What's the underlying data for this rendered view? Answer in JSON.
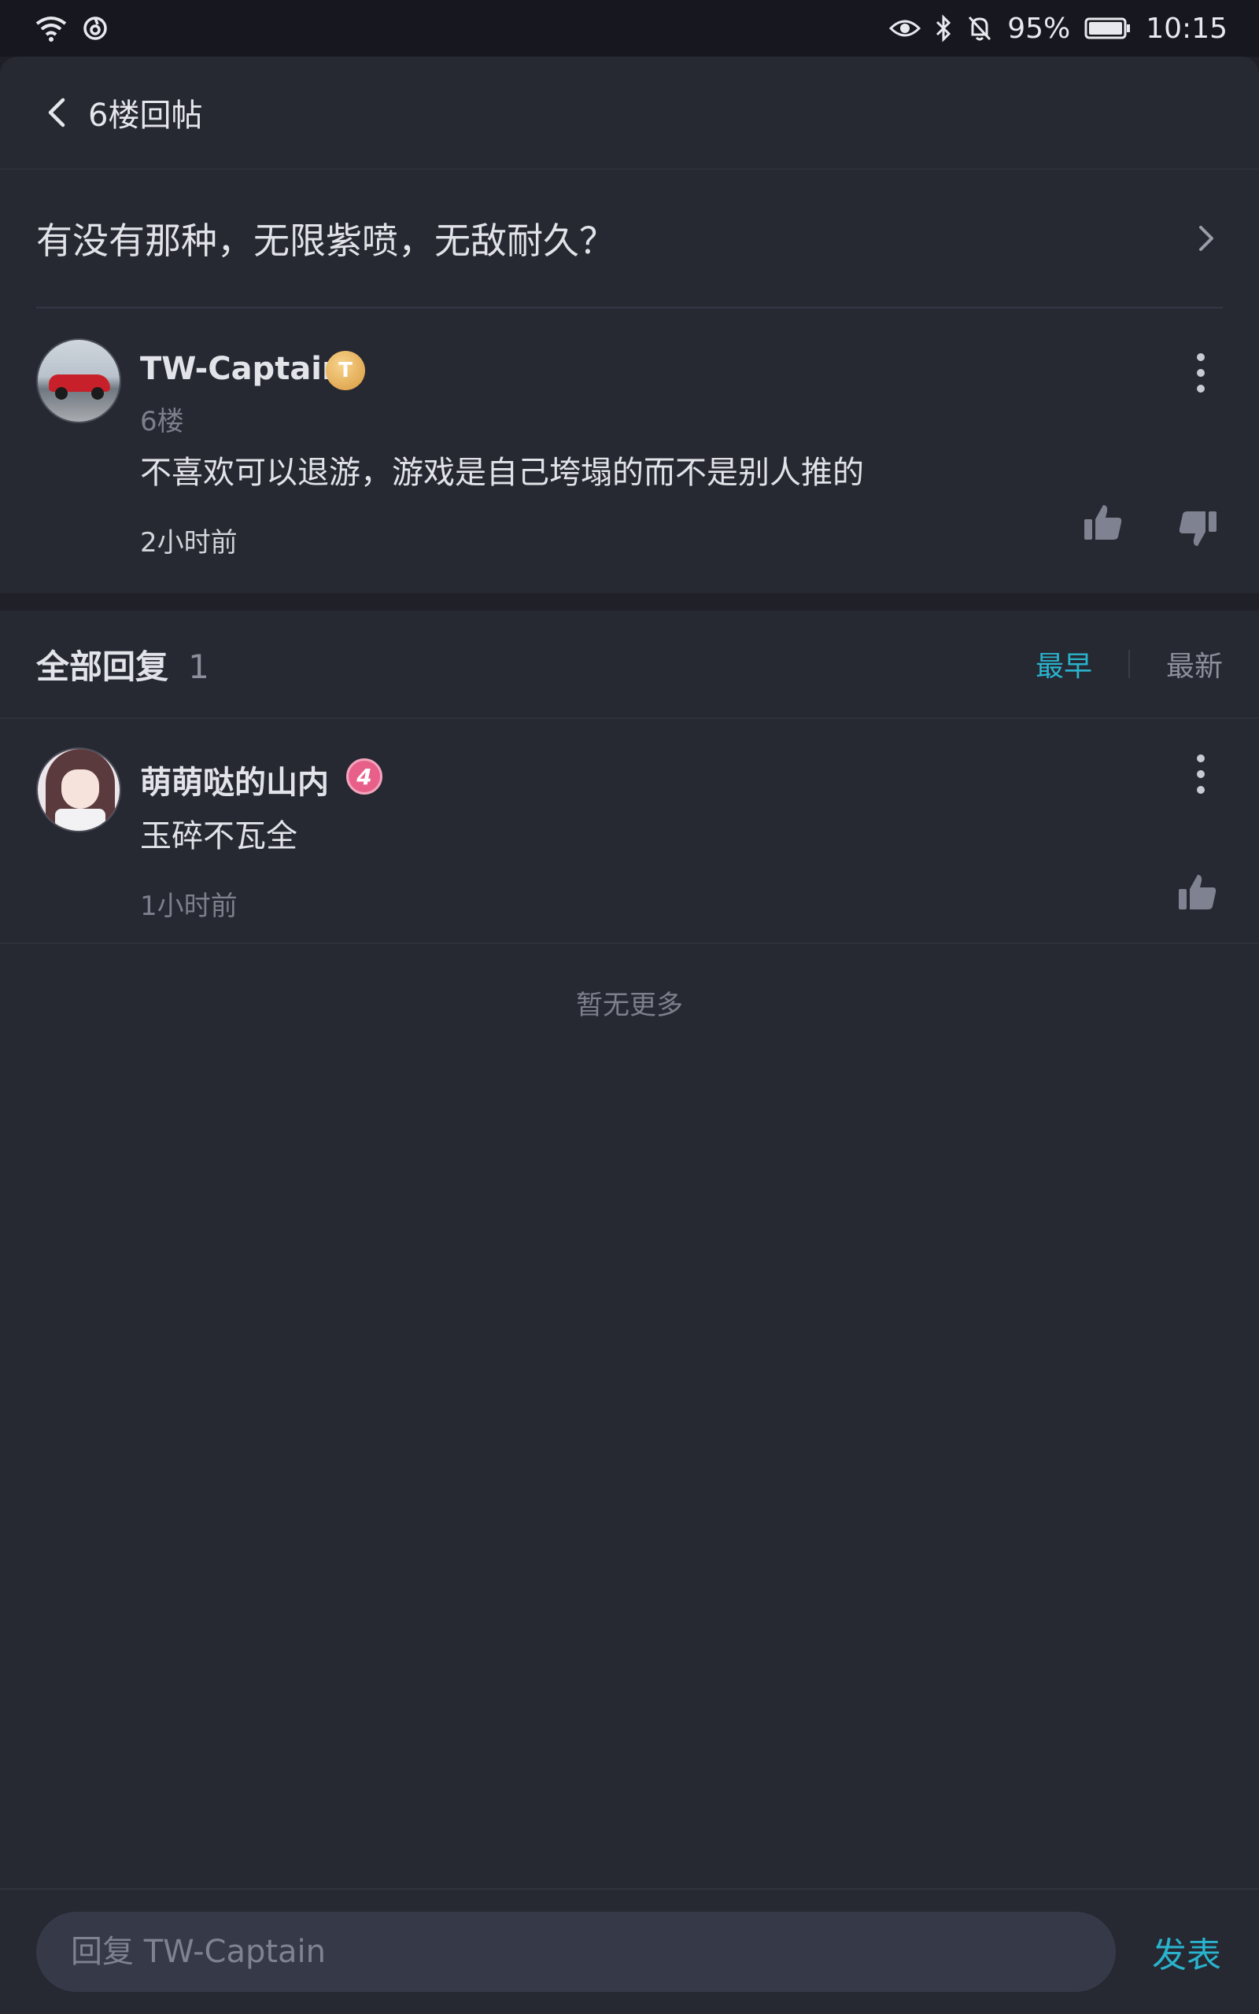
{
  "status_bar": {
    "battery": "95%",
    "time": "10:15"
  },
  "header": {
    "title": "6楼回帖"
  },
  "topic": {
    "title": "有没有那种，无限紫喷，无敌耐久？"
  },
  "post": {
    "username": "TW-Captain",
    "badge": "T",
    "floor": "6楼",
    "content": "不喜欢可以退游，游戏是自己垮塌的而不是别人推的",
    "time": "2小时前"
  },
  "replies": {
    "title": "全部回复",
    "count": "1",
    "sort_earliest": "最早",
    "sort_newest": "最新",
    "active_sort": "最早",
    "items": [
      {
        "username": "萌萌哒的山内",
        "level": "4",
        "content": "玉碎不瓦全",
        "time": "1小时前"
      }
    ]
  },
  "no_more_text": "暂无更多",
  "reply_bar": {
    "placeholder": "回复 TW-Captain",
    "publish_label": "发表"
  },
  "colors": {
    "accent": "#29b3cc",
    "background": "#1e1f27",
    "card": "#262832"
  }
}
